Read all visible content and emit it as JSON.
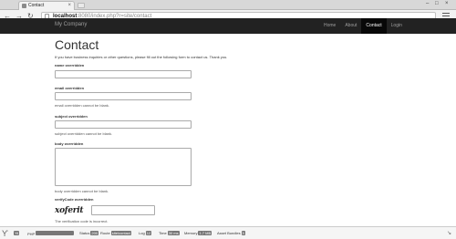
{
  "browser": {
    "tab_title": "Contact",
    "url_host": "localhost",
    "url_rest": ":8080/index.php?r=site/contact"
  },
  "navbar": {
    "brand": "My Company",
    "links": [
      "Home",
      "About",
      "Contact",
      "Login"
    ],
    "active": "Contact"
  },
  "page": {
    "title": "Contact",
    "intro": "If you have business inquiries or other questions, please fill out the following form to contact us. Thank you."
  },
  "form": {
    "name_label": "name overridden",
    "email_label": "email overridden",
    "email_error": "email overridden cannot be blank.",
    "subject_label": "subject overridden",
    "subject_error": "subject overridden cannot be blank.",
    "body_label": "body overridden",
    "body_error": "body overridden cannot be blank.",
    "verify_label": "verifyCode overridden",
    "captcha_text": "xoferit",
    "verify_error": "The verification code is incorrect."
  },
  "debug": {
    "yii": "Yii",
    "php_label": "PHP",
    "status_label": "Status",
    "status_value": "200",
    "route_label": "Route",
    "route_value": "site/contact",
    "log_label": "Log",
    "log_value": "12",
    "time_label": "Time",
    "time_value": "30 ms",
    "memory_label": "Memory",
    "memory_value": "1.7 MB",
    "asset_label": "Asset Bundles",
    "asset_value": "5"
  }
}
